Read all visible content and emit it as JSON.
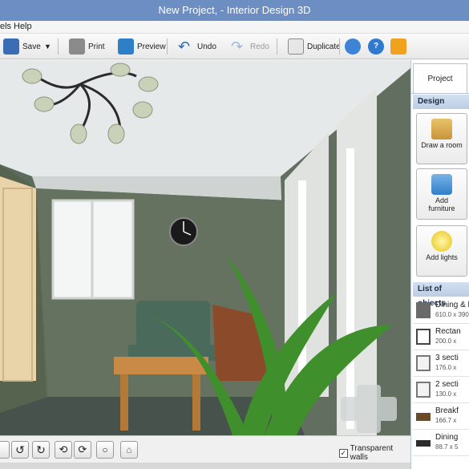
{
  "window": {
    "title": "New Project, - Interior Design 3D"
  },
  "menu": {
    "items": [
      "els",
      "Help"
    ]
  },
  "toolbar": {
    "save_label": "Save",
    "print_label": "Print",
    "preview_label": "Preview",
    "undo_label": "Undo",
    "redo_label": "Redo",
    "duplicate_label": "Duplicate"
  },
  "bottom": {
    "transparent_walls_label": "Transparent walls",
    "transparent_walls_checked": true
  },
  "panel": {
    "tab_label": "Project",
    "design_header": "Design",
    "draw_room_label": "Draw a room",
    "add_furniture_label_1": "Add",
    "add_furniture_label_2": "furniture",
    "add_lights_label": "Add lights",
    "objects_header": "List of objects",
    "objects": [
      {
        "name": "Dining & k",
        "size": "610.0 x 390"
      },
      {
        "name": "Rectan",
        "size": "200.0 x"
      },
      {
        "name": "3 secti",
        "size": "176.0 x"
      },
      {
        "name": "2 secti",
        "size": "130.0 x"
      },
      {
        "name": "Breakf",
        "size": "166.7 x"
      },
      {
        "name": "Dining",
        "size": "88.7 x 5"
      }
    ]
  },
  "colors": {
    "titlebar": "#6d8ec2",
    "wall": "#5f6d5f",
    "ceiling": "#dfe3e4",
    "floor": "#4a5a58"
  }
}
